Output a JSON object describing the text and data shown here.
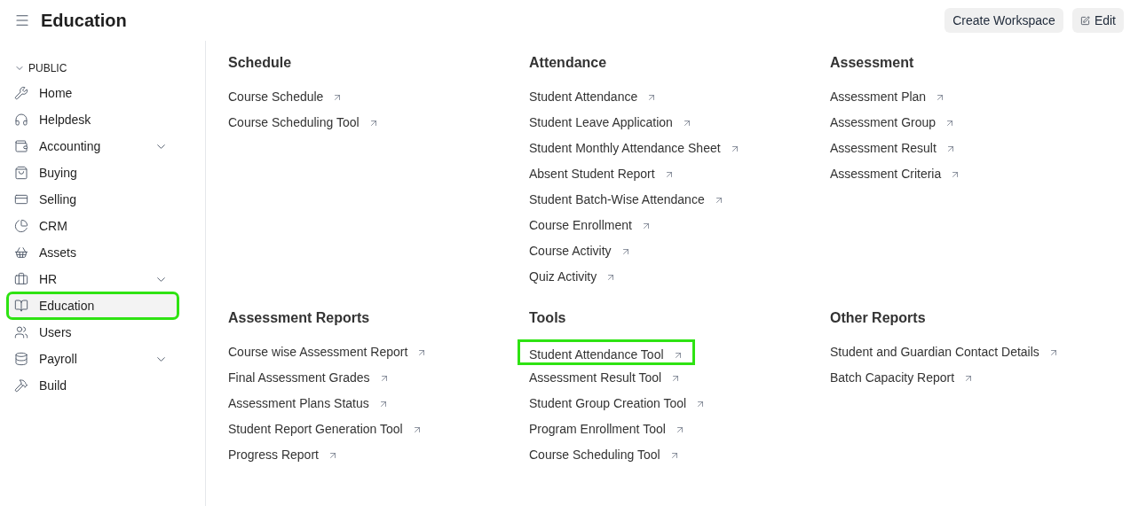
{
  "header": {
    "title": "Education",
    "buttons": [
      {
        "kind": "plain",
        "label": "Create Workspace"
      },
      {
        "kind": "edit",
        "label": "Edit"
      }
    ]
  },
  "sidebar": {
    "section": "PUBLIC",
    "items": [
      {
        "label": "Home",
        "expandable": false,
        "selected": false,
        "highlighted": false
      },
      {
        "label": "Helpdesk",
        "expandable": false,
        "selected": false,
        "highlighted": false
      },
      {
        "label": "Accounting",
        "expandable": true,
        "selected": false,
        "highlighted": false
      },
      {
        "label": "Buying",
        "expandable": false,
        "selected": false,
        "highlighted": false
      },
      {
        "label": "Selling",
        "expandable": false,
        "selected": false,
        "highlighted": false
      },
      {
        "label": "CRM",
        "expandable": false,
        "selected": false,
        "highlighted": false
      },
      {
        "label": "Assets",
        "expandable": false,
        "selected": false,
        "highlighted": false
      },
      {
        "label": "HR",
        "expandable": true,
        "selected": false,
        "highlighted": false
      },
      {
        "label": "Education",
        "expandable": false,
        "selected": true,
        "highlighted": true
      },
      {
        "label": "Users",
        "expandable": false,
        "selected": false,
        "highlighted": false
      },
      {
        "label": "Payroll",
        "expandable": true,
        "selected": false,
        "highlighted": false
      },
      {
        "label": "Build",
        "expandable": false,
        "selected": false,
        "highlighted": false
      }
    ]
  },
  "cards": [
    {
      "title": "Schedule",
      "links": [
        {
          "label": "Course Schedule",
          "highlighted": false
        },
        {
          "label": "Course Scheduling Tool",
          "highlighted": false
        }
      ]
    },
    {
      "title": "Attendance",
      "links": [
        {
          "label": "Student Attendance",
          "highlighted": false
        },
        {
          "label": "Student Leave Application",
          "highlighted": false
        },
        {
          "label": "Student Monthly Attendance Sheet",
          "highlighted": false
        },
        {
          "label": "Absent Student Report",
          "highlighted": false
        },
        {
          "label": "Student Batch-Wise Attendance",
          "highlighted": false
        },
        {
          "label": "Course Enrollment",
          "highlighted": false
        },
        {
          "label": "Course Activity",
          "highlighted": false
        },
        {
          "label": "Quiz Activity",
          "highlighted": false
        }
      ]
    },
    {
      "title": "Assessment",
      "links": [
        {
          "label": "Assessment Plan",
          "highlighted": false
        },
        {
          "label": "Assessment Group",
          "highlighted": false
        },
        {
          "label": "Assessment Result",
          "highlighted": false
        },
        {
          "label": "Assessment Criteria",
          "highlighted": false
        }
      ]
    },
    {
      "title": "Assessment Reports",
      "links": [
        {
          "label": "Course wise Assessment Report",
          "highlighted": false
        },
        {
          "label": "Final Assessment Grades",
          "highlighted": false
        },
        {
          "label": "Assessment Plans Status",
          "highlighted": false
        },
        {
          "label": "Student Report Generation Tool",
          "highlighted": false
        },
        {
          "label": "Progress Report",
          "highlighted": false
        }
      ]
    },
    {
      "title": "Tools",
      "links": [
        {
          "label": "Student Attendance Tool",
          "highlighted": true
        },
        {
          "label": "Assessment Result Tool",
          "highlighted": false
        },
        {
          "label": "Student Group Creation Tool",
          "highlighted": false
        },
        {
          "label": "Program Enrollment Tool",
          "highlighted": false
        },
        {
          "label": "Course Scheduling Tool",
          "highlighted": false
        }
      ]
    },
    {
      "title": "Other Reports",
      "links": [
        {
          "label": "Student and Guardian Contact Details",
          "highlighted": false
        },
        {
          "label": "Batch Capacity Report",
          "highlighted": false
        }
      ]
    }
  ]
}
